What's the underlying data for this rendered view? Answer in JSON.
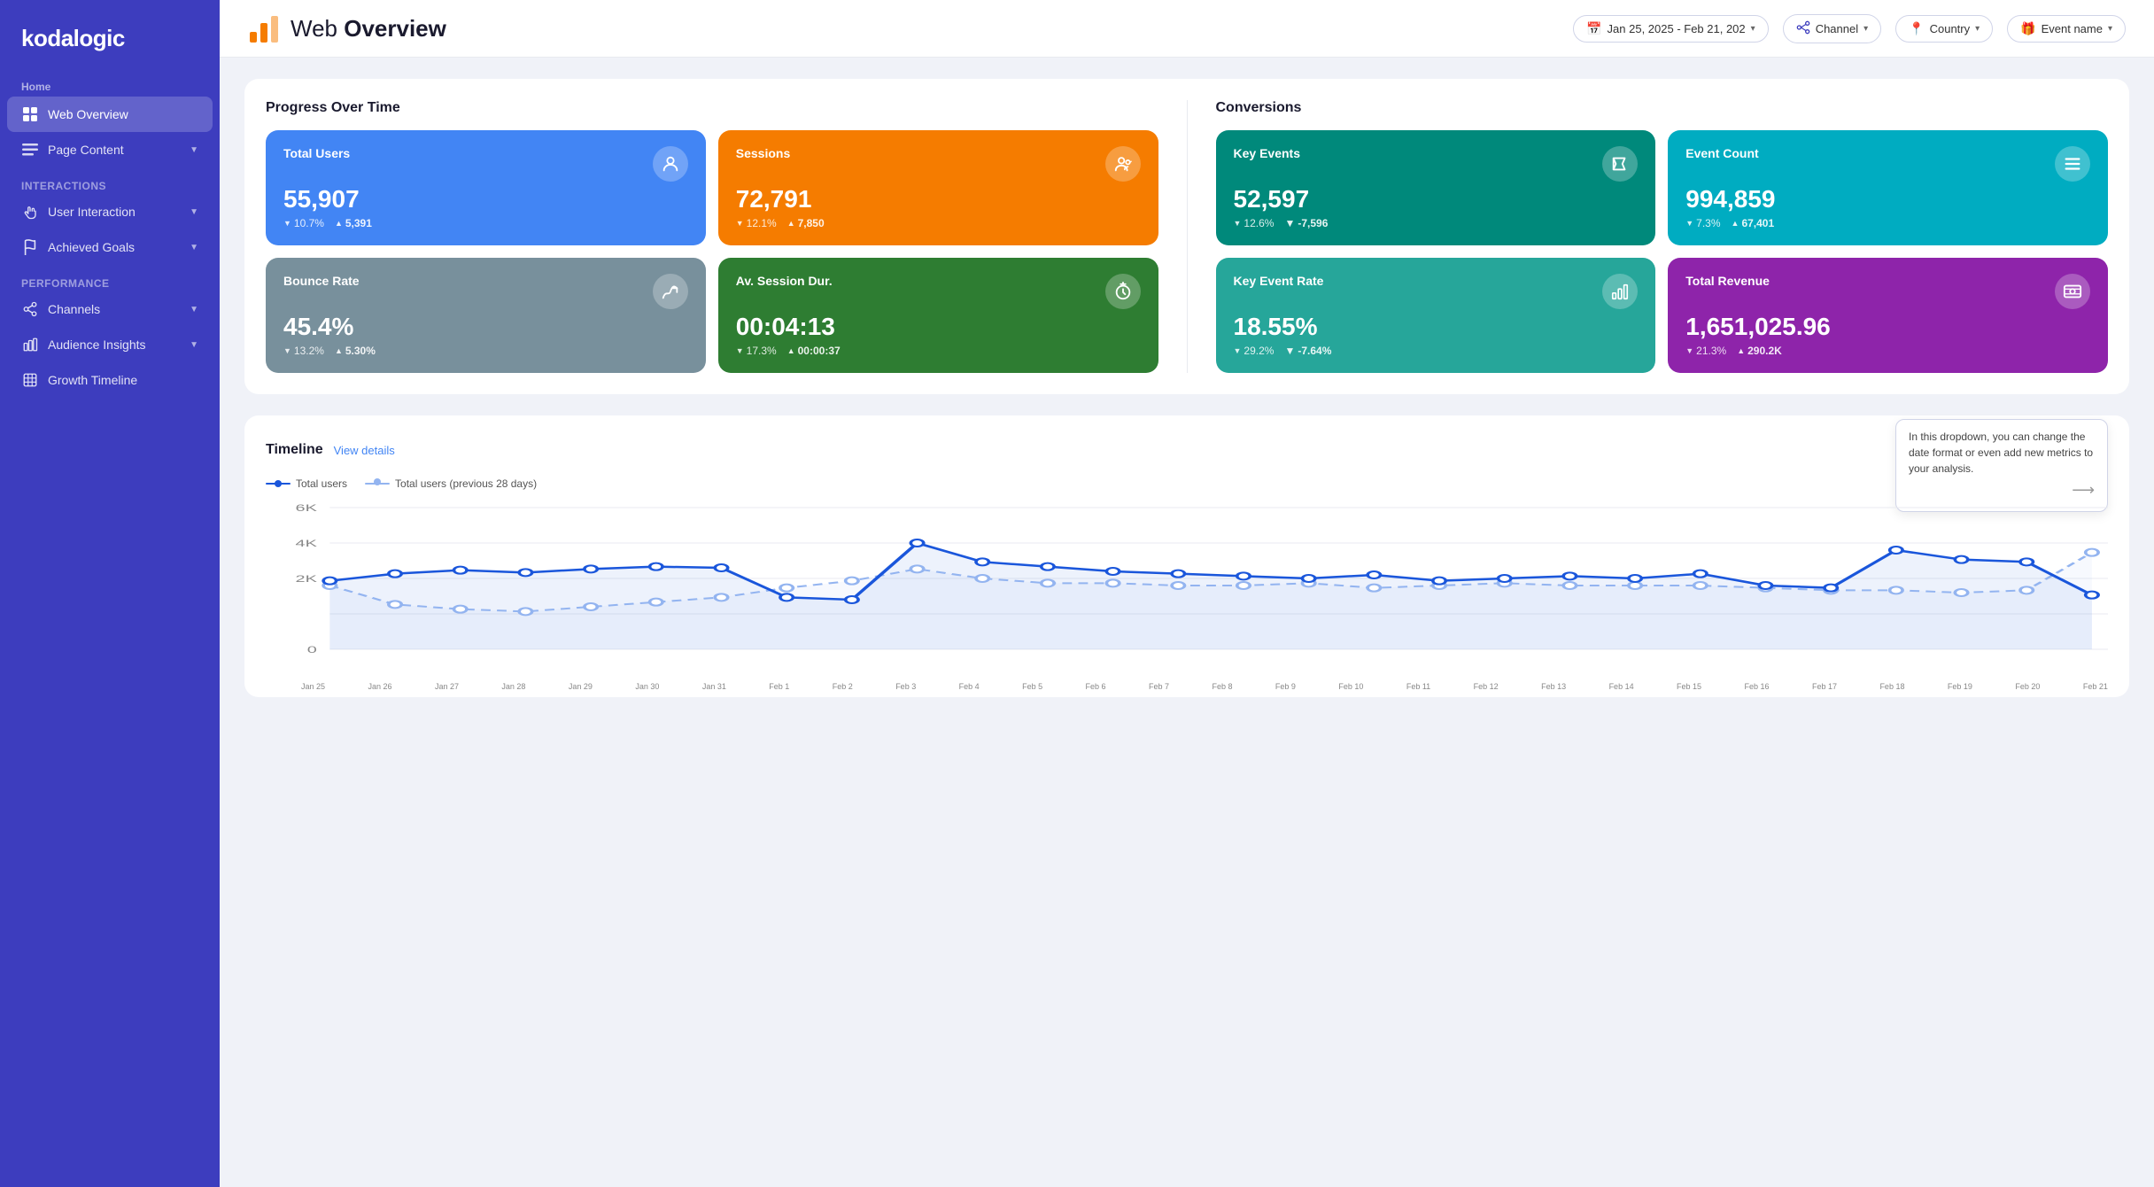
{
  "app": {
    "name": "kodalogic"
  },
  "header": {
    "title_light": "Web",
    "title_bold": "Overview",
    "filters": [
      {
        "id": "date",
        "icon": "📅",
        "label": "Jan 25, 2025 - Feb 21, 202",
        "has_arrow": true
      },
      {
        "id": "channel",
        "icon": "🔀",
        "label": "Channel",
        "has_arrow": true
      },
      {
        "id": "country",
        "icon": "📍",
        "label": "Country",
        "has_arrow": true
      },
      {
        "id": "event",
        "icon": "🎁",
        "label": "Event name",
        "has_arrow": true
      }
    ]
  },
  "sidebar": {
    "home_label": "Home",
    "nav_items": [
      {
        "id": "web-overview",
        "label": "Web Overview",
        "icon": "grid",
        "active": true,
        "has_chevron": false
      },
      {
        "id": "page-content",
        "label": "Page Content",
        "icon": "list",
        "active": false,
        "has_chevron": true
      }
    ],
    "sections": [
      {
        "label": "Interactions",
        "items": [
          {
            "id": "user-interaction",
            "label": "User Interaction",
            "icon": "hand",
            "has_chevron": true
          },
          {
            "id": "achieved-goals",
            "label": "Achieved Goals",
            "icon": "flag",
            "has_chevron": true
          }
        ]
      },
      {
        "label": "Performance",
        "items": [
          {
            "id": "channels",
            "label": "Channels",
            "icon": "share",
            "has_chevron": true
          },
          {
            "id": "audience-insights",
            "label": "Audience Insights",
            "icon": "chart-bar",
            "has_chevron": true
          },
          {
            "id": "growth-timeline",
            "label": "Growth Timeline",
            "icon": "table",
            "has_chevron": false
          }
        ]
      }
    ]
  },
  "progress_over_time": {
    "title": "Progress Over Time",
    "cards": [
      {
        "id": "total-users",
        "label": "Total Users",
        "value": "55,907",
        "change_pct": "10.7%",
        "change_dir": "up",
        "delta": "5,391",
        "delta_dir": "up",
        "color": "blue",
        "icon": "👤"
      },
      {
        "id": "sessions",
        "label": "Sessions",
        "value": "72,791",
        "change_pct": "12.1%",
        "change_dir": "up",
        "delta": "7,850",
        "delta_dir": "up",
        "color": "orange",
        "icon": "👤"
      },
      {
        "id": "bounce-rate",
        "label": "Bounce Rate",
        "value": "45.4%",
        "change_pct": "13.2%",
        "change_dir": "down",
        "delta": "5.30%",
        "delta_dir": "up",
        "color": "gray",
        "icon": "↩"
      },
      {
        "id": "av-session-dur",
        "label": "Av. Session Dur.",
        "value": "00:04:13",
        "change_pct": "17.3%",
        "change_dir": "up",
        "delta": "00:00:37",
        "delta_dir": "up",
        "color": "green",
        "icon": "⏱"
      }
    ]
  },
  "conversions": {
    "title": "Conversions",
    "cards": [
      {
        "id": "key-events",
        "label": "Key Events",
        "value": "52,597",
        "change_pct": "12.6%",
        "change_dir": "down",
        "delta": "-7,596",
        "delta_dir": "down",
        "color": "teal",
        "icon": "🚩"
      },
      {
        "id": "event-count",
        "label": "Event Count",
        "value": "994,859",
        "change_pct": "7.3%",
        "change_dir": "up",
        "delta": "67,401",
        "delta_dir": "up",
        "color": "cyan",
        "icon": "≡"
      },
      {
        "id": "key-event-rate",
        "label": "Key Event Rate",
        "value": "18.55%",
        "change_pct": "29.2%",
        "change_dir": "down",
        "delta": "-7.64%",
        "delta_dir": "down",
        "color": "teal_light",
        "icon": "📊"
      },
      {
        "id": "total-revenue",
        "label": "Total Revenue",
        "value": "1,651,025.96",
        "change_pct": "21.3%",
        "change_dir": "up",
        "delta": "290.2K",
        "delta_dir": "up",
        "color": "purple",
        "icon": "💳"
      }
    ]
  },
  "timeline": {
    "title": "Timeline",
    "link_label": "View details",
    "tooltip": "In this dropdown, you can change the date format or even add new metrics to your analysis.",
    "legend": [
      {
        "id": "total-users",
        "label": "Total users",
        "color": "#1a56db",
        "style": "solid"
      },
      {
        "id": "total-users-prev",
        "label": "Total users (previous 28 days)",
        "color": "#93b4f0",
        "style": "dashed"
      }
    ],
    "y_labels": [
      "6K",
      "4K",
      "2K",
      "0"
    ],
    "x_labels": [
      "Jan 25",
      "Jan 26",
      "Jan 27",
      "Jan 28",
      "Jan 29",
      "Jan 30",
      "Jan 31",
      "Feb 1",
      "Feb 2",
      "Feb 3",
      "Feb 4",
      "Feb 5",
      "Feb 6",
      "Feb 7",
      "Feb 8",
      "Feb 9",
      "Feb 10",
      "Feb 11",
      "Feb 12",
      "Feb 13",
      "Feb 14",
      "Feb 15",
      "Feb 16",
      "Feb 17",
      "Feb 18",
      "Feb 19",
      "Feb 20",
      "Feb 21"
    ],
    "series1": [
      2900,
      3200,
      3350,
      3250,
      3400,
      3500,
      3450,
      2200,
      2100,
      4500,
      3700,
      3500,
      3300,
      3200,
      3100,
      3000,
      3150,
      2900,
      3000,
      3100,
      3000,
      3200,
      2700,
      2600,
      4200,
      3800,
      3700,
      2300
    ],
    "series2": [
      2700,
      1900,
      1700,
      1600,
      1800,
      2000,
      2200,
      2600,
      2900,
      3400,
      3000,
      2800,
      2800,
      2700,
      2700,
      2800,
      2600,
      2700,
      2800,
      2700,
      2700,
      2700,
      2600,
      2500,
      2500,
      2400,
      2500,
      4100
    ]
  }
}
